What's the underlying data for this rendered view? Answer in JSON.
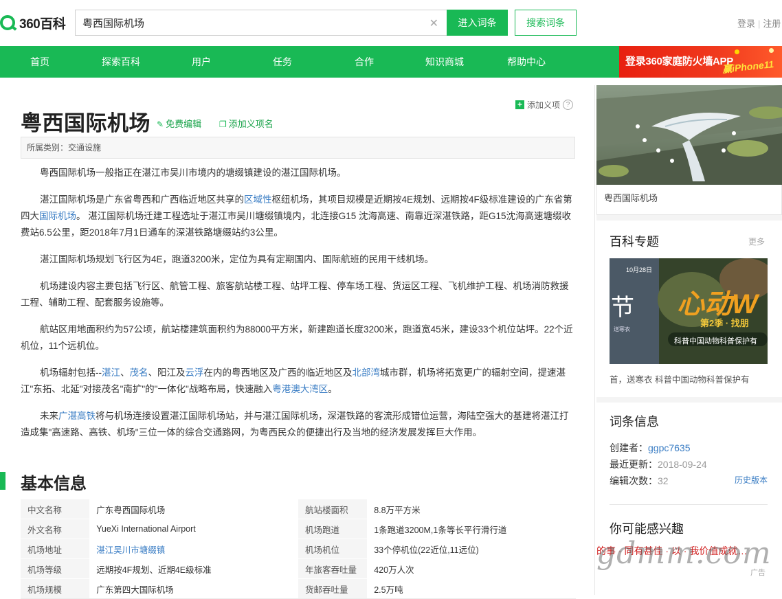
{
  "logo": {
    "text": "360百科"
  },
  "search": {
    "value": "粤西国际机场",
    "enter_label": "进入词条",
    "search_label": "搜索词条"
  },
  "user": {
    "login": "登录",
    "sep": "|",
    "register": "注册"
  },
  "nav": {
    "items": [
      "首页",
      "探索百科",
      "用户",
      "任务",
      "合作",
      "知识商城",
      "帮助中心"
    ],
    "banner_text": "登录360家庭防火墙APP",
    "banner_prize": "赢iPhone11"
  },
  "entry": {
    "add_item": "添加义项",
    "help": "?",
    "title": "粤西国际机场",
    "edit": "免费编辑",
    "add_sense": "添加义项名",
    "category": "所属类别：交通设施",
    "paragraphs": [
      [
        {
          "t": "粤西国际机场一般指正在湛江市吴川市境内的塘缀镇建设的湛江国际机场。"
        }
      ],
      [
        {
          "t": "湛江国际机场是广东省粤西和广西临近地区共享的"
        },
        {
          "t": "区域性",
          "link": true
        },
        {
          "t": "枢纽机场，其项目规模是近期按4E规划、远期按4F级标准建设的广东省第四大"
        },
        {
          "t": "国际机场",
          "link": true
        },
        {
          "t": "。 湛江国际机场迁建工程选址于湛江市吴川塘缀镇境内，北连接G15 沈海高速、南靠近深湛铁路，距G15沈海高速塘缀收费站6.5公里，距2018年7月1日通车的深湛铁路塘缀站约3公里。"
        }
      ],
      [
        {
          "t": "湛江国际机场规划飞行区为4E，跑道3200米，定位为具有定期国内、国际航班的民用干线机场。"
        }
      ],
      [
        {
          "t": "机场建设内容主要包括飞行区、航管工程、旅客航站楼工程、站坪工程、停车场工程、货运区工程、飞机维护工程、机场消防救援工程、辅助工程、配套服务设施等。"
        }
      ],
      [
        {
          "t": "航站区用地面积约为57公顷，航站楼建筑面积约为88000平方米，新建跑道长度3200米，跑道宽45米，建设33个机位站坪。22个近机位，11个远机位。"
        }
      ],
      [
        {
          "t": "机场辐射包括--"
        },
        {
          "t": "湛江",
          "link": true
        },
        {
          "t": "、"
        },
        {
          "t": "茂名",
          "link": true
        },
        {
          "t": "、阳江及"
        },
        {
          "t": "云浮",
          "link": true
        },
        {
          "t": "在内的粤西地区及广西的临近地区及"
        },
        {
          "t": "北部湾",
          "link": true
        },
        {
          "t": "城市群，机场将拓宽更广的辐射空间，提速湛江\"东拓、北延\"对接茂名\"南扩\"的\"一体化\"战略布局，快速融入"
        },
        {
          "t": "粤港澳大湾区",
          "link": true
        },
        {
          "t": "。"
        }
      ],
      [
        {
          "t": "未来"
        },
        {
          "t": "广湛高铁",
          "link": true
        },
        {
          "t": "将与机场连接设置湛江国际机场站，并与湛江国际机场，深湛铁路的客流形成错位运营，海陆空强大的基建将湛江打造成集\"高速路、高铁、机场\"三位一体的综合交通路网，为粤西民众的便捷出行及当地的经济发展发挥巨大作用。"
        }
      ]
    ],
    "basic_info_title": "基本信息",
    "basic_info": [
      {
        "k1": "中文名称",
        "v1": "广东粤西国际机场",
        "k2": "航站楼面积",
        "v2": "8.8万平方米"
      },
      {
        "k1": "外文名称",
        "v1": "YueXi International Airport",
        "k2": "机场跑道",
        "v2": "1条跑道3200M,1条等长平行滑行道"
      },
      {
        "k1": "机场地址",
        "v1": "湛江吴川市塘缀镇",
        "v1_link": true,
        "k2": "机场机位",
        "v2": "33个停机位(22近位,11远位)"
      },
      {
        "k1": "机场等级",
        "v1": "远期按4F规划、近期4E级标准",
        "k2": "年旅客吞吐量",
        "v2": "420万人次"
      },
      {
        "k1": "机场规模",
        "v1": "广东第四大国际机场",
        "k2": "货邮吞吐量",
        "v2": "2.5万吨"
      }
    ]
  },
  "sidebar": {
    "hero_caption": "粤西国际机场",
    "topics_title": "百科专题",
    "more": "更多",
    "promo_date": "10月28日",
    "promo_left_char": "节",
    "promo_left_sub": "送寒衣",
    "promo_big": "心动W",
    "promo_season": "第2季 · 找朋",
    "promo_bottom": "科普中国动物科普保护有",
    "promo_caption": "首，送寒衣 科普中国动物科普保护有",
    "entry_info_title": "词条信息",
    "creator_label": "创建者：",
    "creator": "ggpc7635",
    "updated_label": "最近更新：",
    "updated": "2018-09-24",
    "edits_label": "编辑次数：",
    "edits": "32",
    "history": "历史版本",
    "interest_title": "你可能感兴趣",
    "rec_text": "的事 · 同有甚佳 · 以 · 我价值成就…",
    "ad": "广告",
    "watermark": "gdmm.com"
  },
  "colors": {
    "brand_green": "#19b955",
    "link_blue": "#3a7dc4",
    "banner_red": "#e8200f"
  }
}
